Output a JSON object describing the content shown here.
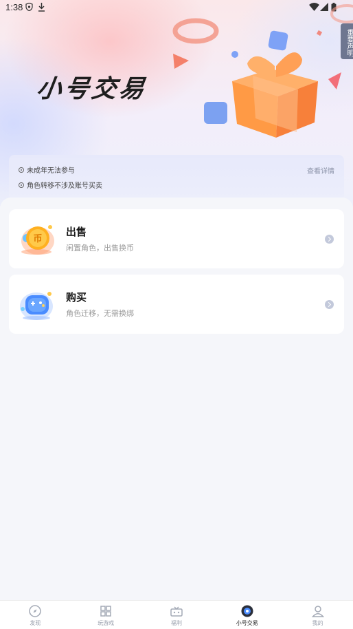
{
  "status_bar": {
    "time": "1:38"
  },
  "hero": {
    "title": "小号交易",
    "notice_tab": "重要声明"
  },
  "notice": {
    "lines": [
      "未成年无法参与",
      "角色转移不涉及账号买卖"
    ],
    "link": "查看详情"
  },
  "cards": [
    {
      "title": "出售",
      "subtitle": "闲置角色，出售换币",
      "icon": "coin-icon"
    },
    {
      "title": "购买",
      "subtitle": "角色迁移，无需换绑",
      "icon": "gamepad-icon"
    }
  ],
  "bottom_nav": [
    {
      "label": "发现",
      "icon": "compass-icon",
      "active": false
    },
    {
      "label": "玩游戏",
      "icon": "grid-icon",
      "active": false
    },
    {
      "label": "福利",
      "icon": "gift-box-icon",
      "active": false
    },
    {
      "label": "小号交易",
      "icon": "trade-icon",
      "active": true
    },
    {
      "label": "我的",
      "icon": "user-icon",
      "active": false
    }
  ],
  "colors": {
    "accent_orange": "#ff8a3d",
    "notice_bg": "#e9ebfb",
    "page_bg": "#f5f6fa"
  }
}
